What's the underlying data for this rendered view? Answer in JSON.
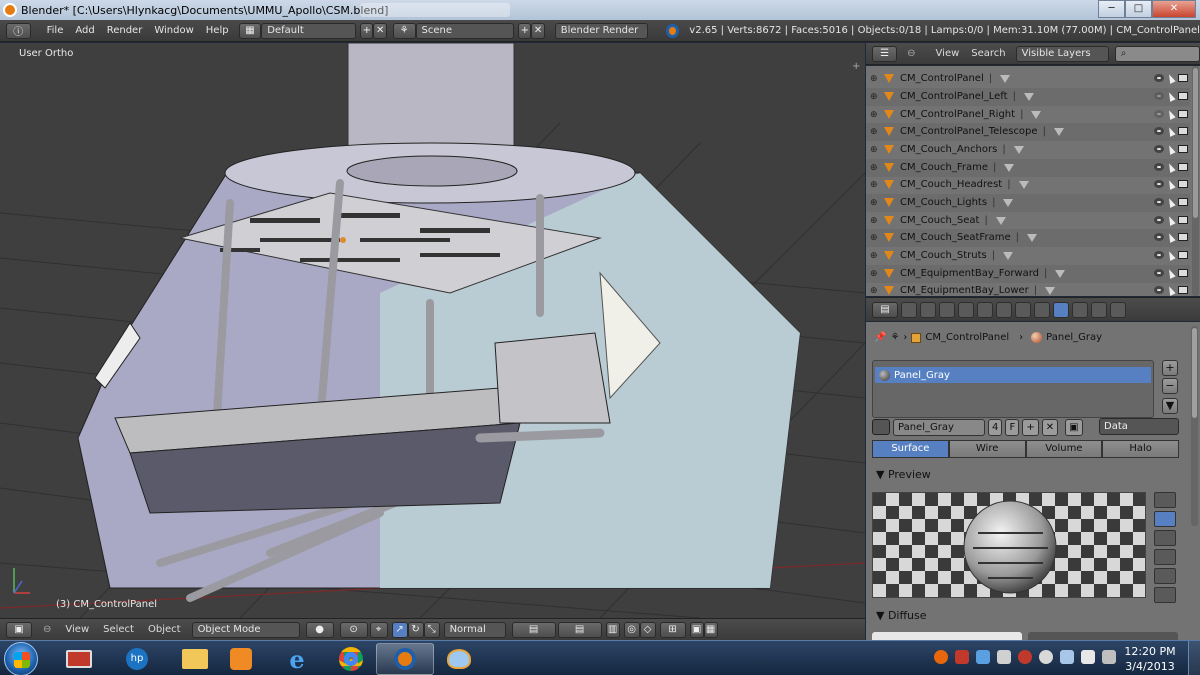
{
  "window": {
    "title": "Blender* [C:\\Users\\Hlynkacg\\Documents\\UMMU_Apollo\\CSM.blend]",
    "min_label": "─",
    "max_label": "□",
    "close_label": "✕"
  },
  "info": {
    "menu": [
      "File",
      "Add",
      "Render",
      "Window",
      "Help"
    ],
    "screen_layout": "Default",
    "scene": "Scene",
    "render_engine": "Blender Render",
    "stats": "v2.65 | Verts:8672 | Faces:5016 | Objects:0/18 | Lamps:0/0 | Mem:31.10M (77.00M) | CM_ControlPanel"
  },
  "viewport": {
    "view_label": "User Ortho",
    "object_label": "(3) CM_ControlPanel",
    "header_menu": [
      "View",
      "Select",
      "Object"
    ],
    "mode": "Object Mode",
    "orientation": "Normal"
  },
  "outliner": {
    "menu": [
      "View",
      "Search"
    ],
    "filter": "Visible Layers",
    "rows": [
      {
        "name": "CM_ControlPanel",
        "dim": false
      },
      {
        "name": "CM_ControlPanel_Left",
        "dim": true
      },
      {
        "name": "CM_ControlPanel_Right",
        "dim": true
      },
      {
        "name": "CM_ControlPanel_Telescope",
        "dim": false
      },
      {
        "name": "CM_Couch_Anchors",
        "dim": false
      },
      {
        "name": "CM_Couch_Frame",
        "dim": false
      },
      {
        "name": "CM_Couch_Headrest",
        "dim": false
      },
      {
        "name": "CM_Couch_Lights",
        "dim": false
      },
      {
        "name": "CM_Couch_Seat",
        "dim": false
      },
      {
        "name": "CM_Couch_SeatFrame",
        "dim": false
      },
      {
        "name": "CM_Couch_Struts",
        "dim": false
      },
      {
        "name": "CM_EquipmentBay_Forward",
        "dim": false
      },
      {
        "name": "CM_EquipmentBay_Lower",
        "dim": false
      }
    ]
  },
  "properties": {
    "breadcrumb_object": "CM_ControlPanel",
    "breadcrumb_material": "Panel_Gray",
    "slot_item": "Panel_Gray",
    "add_label": "+",
    "remove_label": "−",
    "more_label": "▼",
    "material_name": "Panel_Gray",
    "users": "4",
    "fake_user": "F",
    "link": "Data",
    "tabs": [
      "Surface",
      "Wire",
      "Volume",
      "Halo"
    ],
    "preview_title": "▼ Preview",
    "diffuse_title": "▼ Diffuse"
  },
  "taskbar": {
    "time": "12:20 PM",
    "date": "3/4/2013"
  },
  "colors": {
    "accent": "#5680c2",
    "object_orange": "#e2871a"
  }
}
